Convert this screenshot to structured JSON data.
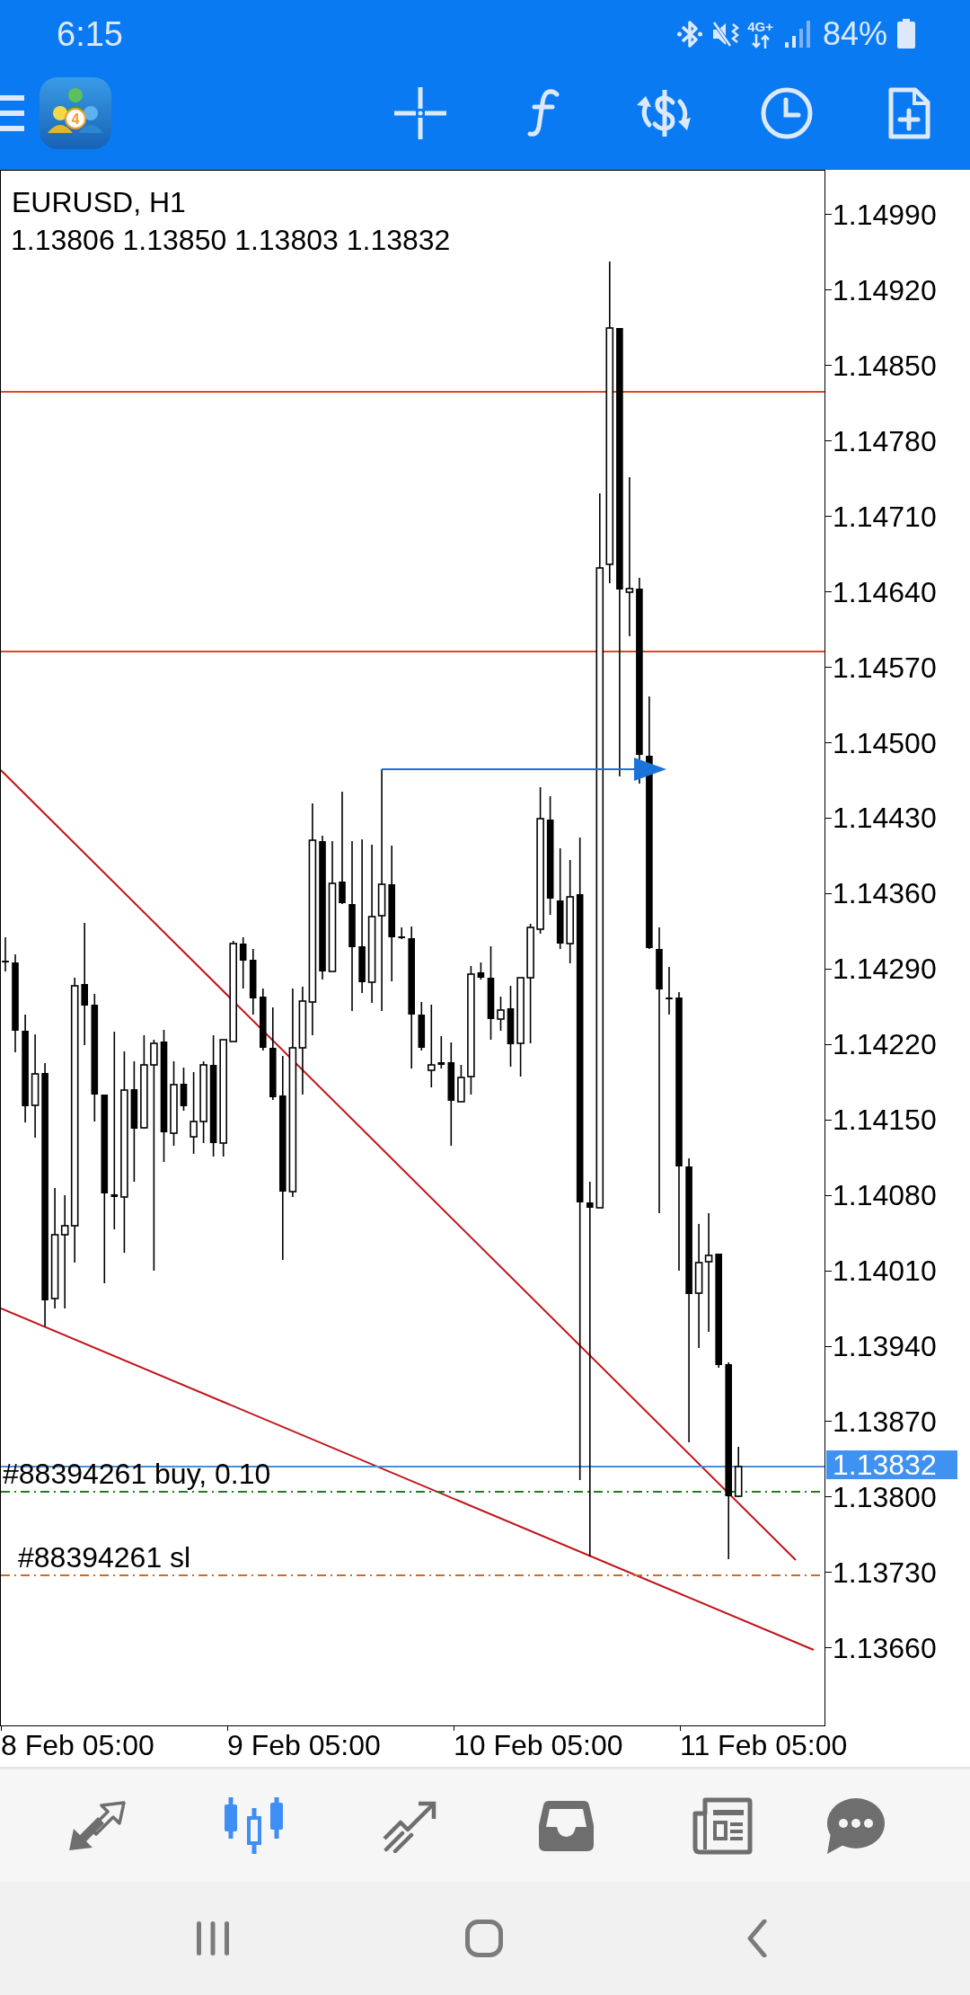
{
  "status_bar": {
    "time": "6:15",
    "network": "4G+",
    "battery": "84%"
  },
  "app_logo": {
    "badge": "4"
  },
  "chart": {
    "symbol": "EURUSD, H1",
    "ohlc": "1.13806 1.13850 1.13803 1.13832",
    "price_labels": [
      "1.14990",
      "1.14920",
      "1.14850",
      "1.14780",
      "1.14710",
      "1.14640",
      "1.14570",
      "1.14500",
      "1.14430",
      "1.14360",
      "1.14290",
      "1.14220",
      "1.14150",
      "1.14080",
      "1.14010",
      "1.13940",
      "1.13870",
      "1.13800",
      "1.13730",
      "1.13660"
    ],
    "current_price": "1.13832",
    "time_labels": [
      "8 Feb 05:00",
      "9 Feb 05:00",
      "10 Feb 05:00",
      "11 Feb 05:00"
    ],
    "orders": [
      {
        "kind": "entry",
        "label": "#88394261 buy, 0.10"
      },
      {
        "kind": "stop_loss",
        "label": "#88394261 sl"
      }
    ]
  },
  "bottom_nav": [
    {
      "selected": false
    },
    {
      "selected": true
    },
    {
      "selected": false
    },
    {
      "selected": false
    },
    {
      "selected": false
    },
    {
      "selected": false
    }
  ]
}
